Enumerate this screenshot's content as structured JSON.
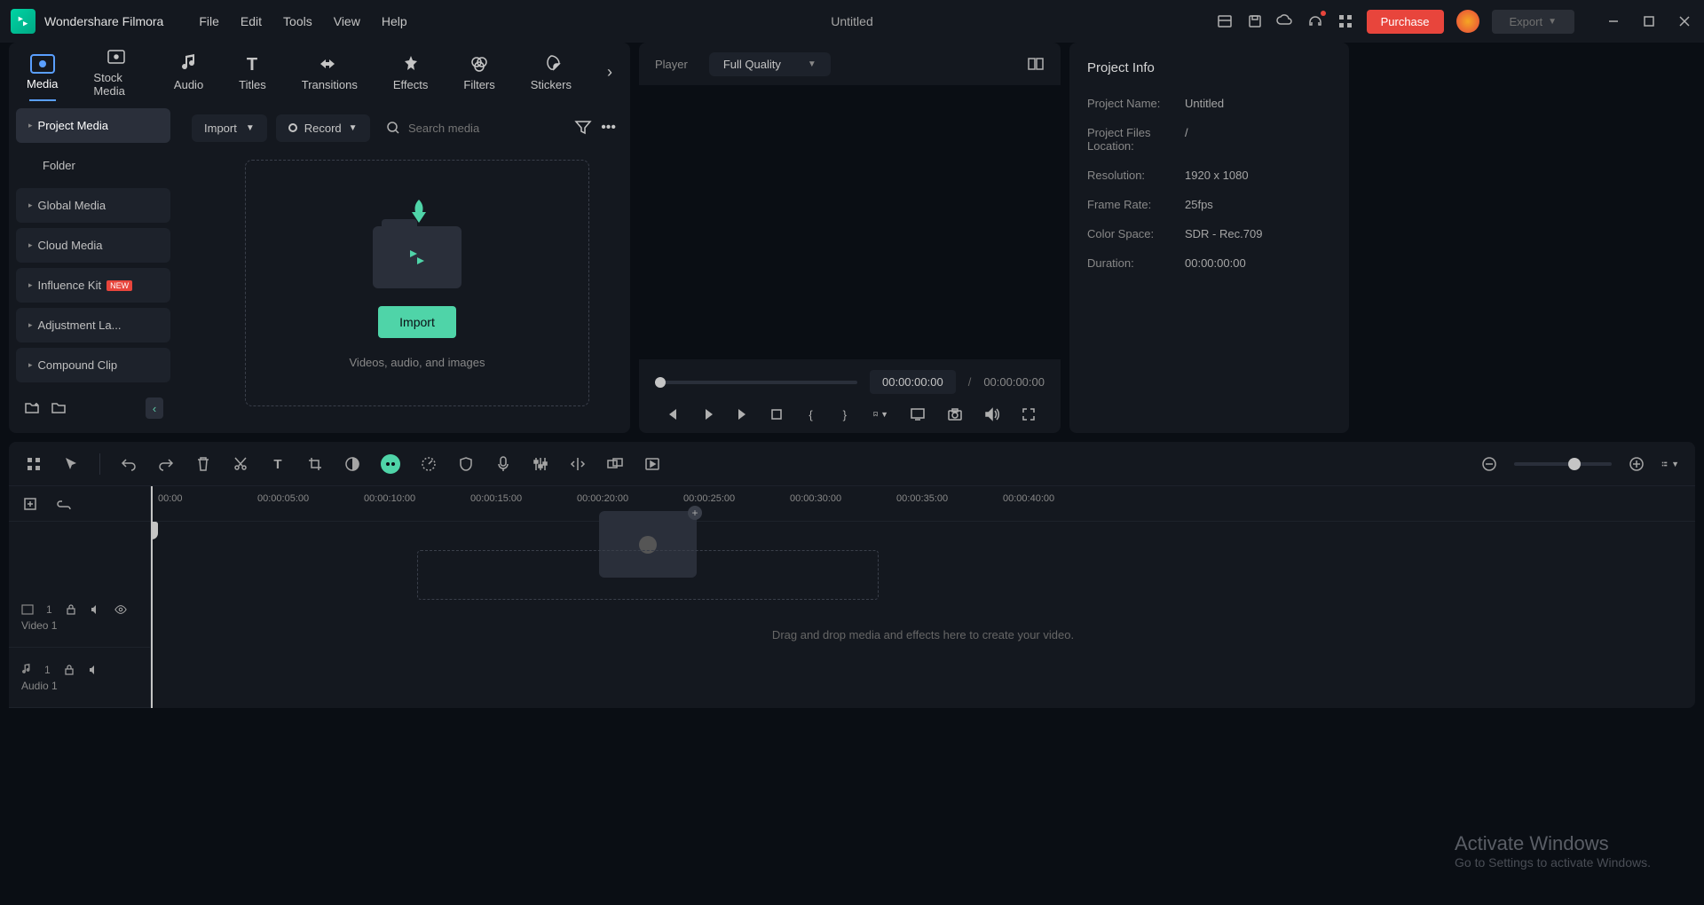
{
  "app": {
    "name": "Wondershare Filmora",
    "document_title": "Untitled"
  },
  "menu": {
    "file": "File",
    "edit": "Edit",
    "tools": "Tools",
    "view": "View",
    "help": "Help"
  },
  "titlebar": {
    "purchase": "Purchase",
    "export": "Export"
  },
  "tabs": {
    "media": "Media",
    "stock": "Stock Media",
    "audio": "Audio",
    "titles": "Titles",
    "transitions": "Transitions",
    "effects": "Effects",
    "filters": "Filters",
    "stickers": "Stickers"
  },
  "toolbar": {
    "import": "Import",
    "record": "Record",
    "search_placeholder": "Search media"
  },
  "sidebar": {
    "items": [
      {
        "label": "Project Media"
      },
      {
        "label": "Folder"
      },
      {
        "label": "Global Media"
      },
      {
        "label": "Cloud Media"
      },
      {
        "label": "Influence Kit"
      },
      {
        "label": "Adjustment La..."
      },
      {
        "label": "Compound Clip"
      }
    ],
    "new_badge": "NEW"
  },
  "dropzone": {
    "button": "Import",
    "hint": "Videos, audio, and images"
  },
  "player": {
    "label": "Player",
    "quality": "Full Quality",
    "current_time": "00:00:00:00",
    "separator": "/",
    "total_time": "00:00:00:00"
  },
  "project_info": {
    "title": "Project Info",
    "rows": [
      {
        "label": "Project Name:",
        "value": "Untitled"
      },
      {
        "label": "Project Files Location:",
        "value": "/"
      },
      {
        "label": "Resolution:",
        "value": "1920 x 1080"
      },
      {
        "label": "Frame Rate:",
        "value": "25fps"
      },
      {
        "label": "Color Space:",
        "value": "SDR - Rec.709"
      },
      {
        "label": "Duration:",
        "value": "00:00:00:00"
      }
    ]
  },
  "timeline": {
    "marks": [
      "00:00",
      "00:00:05:00",
      "00:00:10:00",
      "00:00:15:00",
      "00:00:20:00",
      "00:00:25:00",
      "00:00:30:00",
      "00:00:35:00",
      "00:00:40:00"
    ],
    "tracks": {
      "video": "Video 1",
      "audio": "Audio 1",
      "video_num": "1",
      "audio_num": "1"
    },
    "hint": "Drag and drop media and effects here to create your video."
  },
  "watermark": {
    "title": "Activate Windows",
    "sub": "Go to Settings to activate Windows."
  }
}
